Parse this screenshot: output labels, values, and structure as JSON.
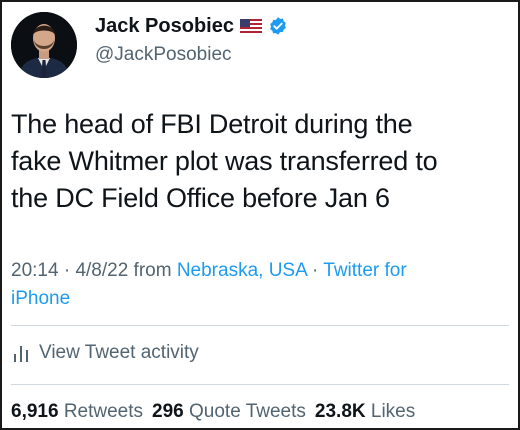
{
  "author": {
    "name": "Jack Posobiec",
    "handle": "@JackPosobiec",
    "flag_icon": "us-flag-icon",
    "verified_icon": "verified-badge-icon"
  },
  "tweet": {
    "lines": [
      "The head of FBI Detroit during the",
      "fake Whitmer plot was transferred to",
      "the DC Field Office before Jan 6"
    ]
  },
  "meta": {
    "time": "20:14",
    "sep1": " · ",
    "date": "4/8/22",
    "from": " from ",
    "location": "Nebraska, USA",
    "sep2": " · ",
    "source_line1": "Twitter for",
    "source_line2": "iPhone"
  },
  "activity": {
    "label": "View Tweet activity",
    "icon": "bar-chart-icon"
  },
  "stats": {
    "retweets_count": "6,916",
    "retweets_label": "Retweets",
    "quotes_count": "296",
    "quotes_label": "Quote Tweets",
    "likes_count": "23.8K",
    "likes_label": "Likes"
  },
  "colors": {
    "text": "#0f1419",
    "secondary": "#536471",
    "link": "#1d9bf0",
    "verified": "#1d9bf0",
    "divider": "#cfd9de"
  }
}
